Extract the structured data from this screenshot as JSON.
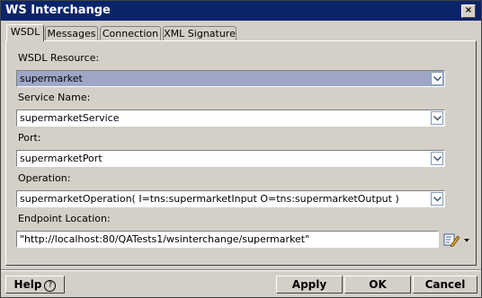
{
  "window": {
    "title": "WS Interchange",
    "close_glyph": "×"
  },
  "tabs": [
    {
      "label": "WSDL",
      "active": true
    },
    {
      "label": "Messages",
      "active": false
    },
    {
      "label": "Connection",
      "active": false
    },
    {
      "label": "XML Signature",
      "active": false
    }
  ],
  "form": {
    "wsdl_resource": {
      "label": "WSDL Resource:",
      "value": "supermarket"
    },
    "service_name": {
      "label": "Service Name:",
      "value": "supermarketService"
    },
    "port": {
      "label": "Port:",
      "value": "supermarketPort"
    },
    "operation": {
      "label": "Operation:",
      "value": "supermarketOperation( I=tns:supermarketInput O=tns:supermarketOutput )"
    },
    "endpoint_location": {
      "label": "Endpoint Location:",
      "value": "\"http://localhost:80/QATests1/wsinterchange/supermarket\""
    }
  },
  "buttons": {
    "help": "Help",
    "help_glyph": "?",
    "apply": "Apply",
    "ok": "OK",
    "cancel": "Cancel"
  },
  "icons": {
    "close": "close-icon",
    "dropdown": "chevron-down-icon",
    "edit": "edit-expression-icon",
    "help": "question-icon"
  },
  "colors": {
    "titlebar": "#0a246a",
    "selection": "#9ea7c8",
    "face": "#d4d0c8"
  }
}
